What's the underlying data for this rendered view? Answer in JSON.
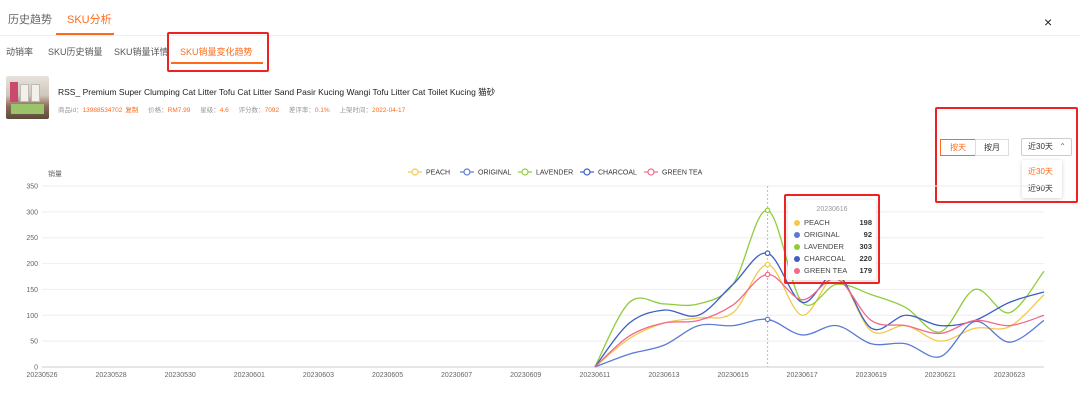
{
  "top_tabs": [
    {
      "label": "历史趋势",
      "active": false
    },
    {
      "label": "SKU分析",
      "active": true
    }
  ],
  "close_symbol": "×",
  "sub_tabs": [
    {
      "label": "动销率",
      "active": false
    },
    {
      "label": "SKU历史销量",
      "active": false
    },
    {
      "label": "SKU销量详情",
      "active": false
    },
    {
      "label": "SKU销量变化趋势",
      "active": true
    }
  ],
  "product": {
    "title": "RSS_ Premium Super Clumping Cat Litter Tofu Cat Litter Sand Pasir Kucing Wangi Tofu Litter Cat Toilet Kucing 猫砂",
    "meta": [
      {
        "label": "商品id：",
        "value": "13988534702"
      },
      {
        "label": "价格：",
        "value": "RM7.99"
      },
      {
        "label": "星级：",
        "value": "4.6"
      },
      {
        "label": "评分数：",
        "value": "7092"
      },
      {
        "label": "差评率：",
        "value": "0.1%"
      },
      {
        "label": "上架时间：",
        "value": "2022-04-17"
      }
    ],
    "copy_label": "复制"
  },
  "controls": {
    "by_day": "按天",
    "by_month": "按月",
    "range_selected": "近30天",
    "range_options": [
      "近30天",
      "近90天"
    ]
  },
  "chart_data": {
    "type": "line",
    "ylabel": "销量",
    "ylim": [
      0,
      350
    ],
    "yticks": [
      0,
      50,
      100,
      150,
      200,
      250,
      300,
      350
    ],
    "x": [
      "20230526",
      "20230527",
      "20230528",
      "20230529",
      "20230530",
      "20230531",
      "20230601",
      "20230602",
      "20230603",
      "20230604",
      "20230605",
      "20230606",
      "20230607",
      "20230608",
      "20230609",
      "20230610",
      "20230611",
      "20230612",
      "20230613",
      "20230614",
      "20230615",
      "20230616",
      "20230617",
      "20230618",
      "20230619",
      "20230620",
      "20230621",
      "20230622",
      "20230623",
      "20230624"
    ],
    "xtick_labels": [
      "20230526",
      "20230528",
      "20230530",
      "20230601",
      "20230603",
      "20230605",
      "20230607",
      "20230609",
      "20230611",
      "20230613",
      "20230615",
      "20230617",
      "20230619",
      "20230621",
      "20230623"
    ],
    "series": [
      {
        "name": "PEACH",
        "color": "#f2c94c",
        "values": [
          0,
          0,
          0,
          0,
          0,
          0,
          0,
          0,
          0,
          0,
          0,
          0,
          0,
          0,
          0,
          0,
          0,
          55,
          85,
          95,
          105,
          198,
          100,
          175,
          70,
          80,
          50,
          75,
          78,
          140
        ]
      },
      {
        "name": "ORIGINAL",
        "color": "#5b7bd5",
        "values": [
          0,
          0,
          0,
          0,
          0,
          0,
          0,
          0,
          0,
          0,
          0,
          0,
          0,
          0,
          0,
          0,
          0,
          25,
          42,
          80,
          80,
          92,
          62,
          80,
          45,
          45,
          20,
          88,
          48,
          90
        ]
      },
      {
        "name": "LAVENDER",
        "color": "#8fcc3c",
        "values": [
          0,
          0,
          0,
          0,
          0,
          0,
          0,
          0,
          0,
          0,
          0,
          0,
          0,
          0,
          0,
          0,
          0,
          125,
          122,
          122,
          160,
          303,
          125,
          160,
          140,
          115,
          68,
          150,
          105,
          185
        ]
      },
      {
        "name": "CHARCOAL",
        "color": "#3d5fc4",
        "values": [
          0,
          0,
          0,
          0,
          0,
          0,
          0,
          0,
          0,
          0,
          0,
          0,
          0,
          0,
          0,
          0,
          0,
          85,
          110,
          100,
          160,
          220,
          125,
          180,
          75,
          100,
          80,
          90,
          125,
          145
        ]
      },
      {
        "name": "GREEN TEA",
        "color": "#f06a8a",
        "values": [
          0,
          0,
          0,
          0,
          0,
          0,
          0,
          0,
          0,
          0,
          0,
          0,
          0,
          0,
          0,
          0,
          0,
          60,
          85,
          90,
          120,
          179,
          130,
          170,
          90,
          80,
          65,
          90,
          80,
          100
        ]
      }
    ],
    "tooltip": {
      "x": "20230616",
      "index": 21
    },
    "grid": true,
    "legend": "top-center"
  }
}
